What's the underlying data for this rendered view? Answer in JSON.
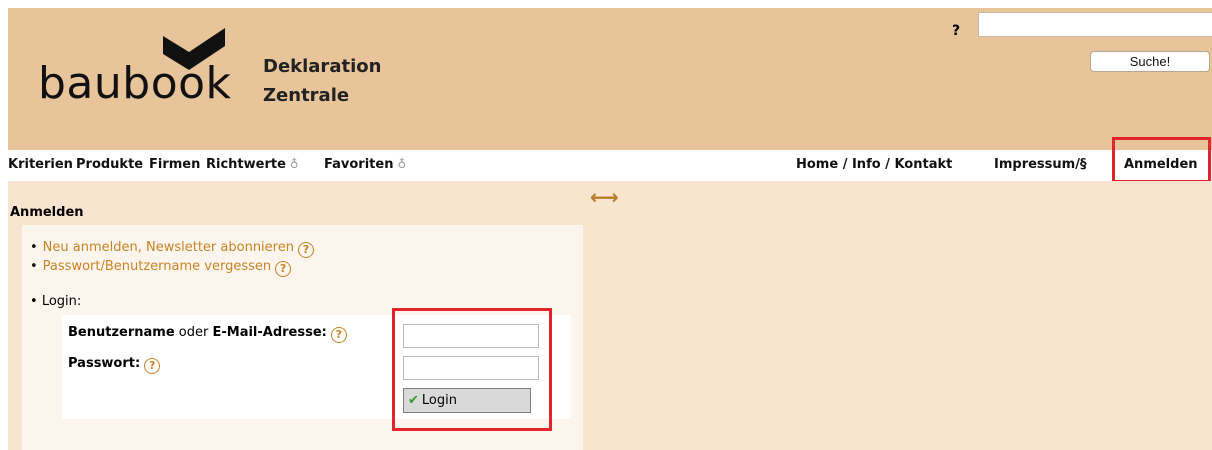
{
  "header": {
    "logo_text": "baubook",
    "brand_line1": "Deklaration",
    "brand_line2": "Zentrale",
    "help_icon": "?",
    "search_value": "",
    "search_button": "Suche!"
  },
  "nav": {
    "left": [
      "Kriterien",
      "Produkte",
      "Firmen",
      "Richtwerte",
      "Favoriten"
    ],
    "key_icon": "key-icon",
    "right": [
      "Home / Info / Kontakt",
      "Impressum/§",
      "Anmelden"
    ]
  },
  "content": {
    "arrow": "⟷",
    "section_title": "Anmelden",
    "links": [
      "Neu anmelden, Newsletter abonnieren",
      "Passwort/Benutzername vergessen"
    ],
    "login_label": "Login:",
    "username_label_bold1": "Benutzername",
    "username_label_mid": "oder",
    "username_label_bold2": "E-Mail-Adresse:",
    "password_label": "Passwort:",
    "username_value": "",
    "password_value": "",
    "login_button": "Login",
    "help_glyph": "?"
  },
  "colors": {
    "header_bg": "#e8c49a",
    "content_bg": "#f9e5cf",
    "link": "#c98424",
    "highlight": "#e3252b"
  }
}
